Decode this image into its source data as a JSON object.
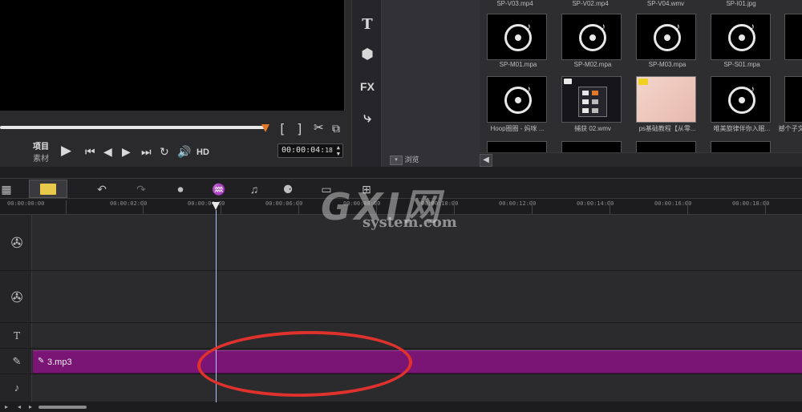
{
  "preview": {
    "mode_project": "项目",
    "mode_clip": "素材",
    "hd_label": "HD",
    "timecode": "00:00:04:",
    "timecode_frames": "18"
  },
  "dock": {
    "icons": [
      "title-icon",
      "transition-icon",
      "fx-icon",
      "path-icon"
    ],
    "fx_label": "FX",
    "title_label": "T"
  },
  "library": {
    "browse_label": "浏览",
    "top_captions": [
      "SP-V03.mp4",
      "SP-V02.mp4",
      "SP-V04.wmv",
      "SP-I01.jpg",
      ""
    ],
    "row1_captions": [
      "SP-M01.mpa",
      "SP-M02.mpa",
      "SP-M03.mpa",
      "SP-S01.mpa",
      ""
    ],
    "row2_captions": [
      "Hoop圈圈 - 妈咪 ...",
      "捕获 02.wmv",
      "ps基础教程【从零...",
      "唯美旋律伴你入眠...",
      "撼个子文..."
    ]
  },
  "ruler": {
    "labels": [
      "00:00:00:00",
      "00:00:02:00",
      "00:00:04:00",
      "00:00:06:00",
      "00:00:08:00",
      "00:00:10:00",
      "00:00:12:00",
      "00:00:14:00",
      "00:00:16:00",
      "00:00:18:00"
    ]
  },
  "timeline": {
    "audio_clip_name": "3.mp3",
    "playhead_time": "00:00:04:18"
  },
  "watermark": {
    "big": "GXI网",
    "small": "system.com"
  },
  "colors": {
    "audio_clip": "#7a1475",
    "annotation": "#e0322c",
    "playhead": "#a8c4ff",
    "scrub_thumb": "#e07a2a",
    "timeline_view_active": "#e8c94a"
  }
}
